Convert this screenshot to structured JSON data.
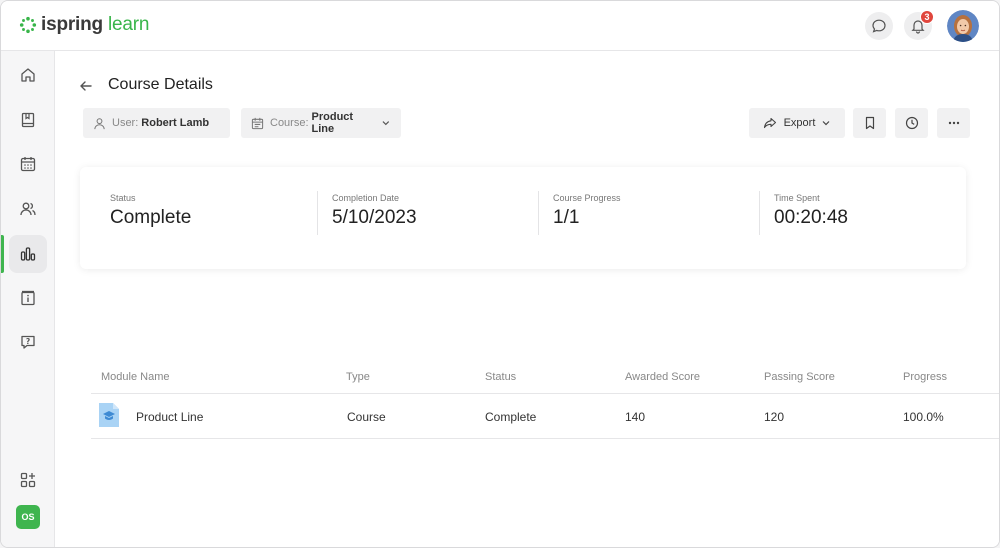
{
  "app": {
    "logo_brand": "ispring",
    "logo_product": "learn",
    "accent": "#3fb54f"
  },
  "header": {
    "notifications_count": "3"
  },
  "sidebar": {
    "items": [
      "home-icon",
      "book-icon",
      "calendar-icon",
      "users-icon",
      "reports-icon",
      "info-icon",
      "help-icon"
    ],
    "active_index": 4,
    "apps_icon": "apps-add-icon",
    "user_initials": "OS"
  },
  "page": {
    "title": "Course Details"
  },
  "filters": {
    "user_label": "User:",
    "user_value": "Robert Lamb",
    "course_label": "Course:",
    "course_value": "Product Line"
  },
  "toolbar": {
    "export_label": "Export"
  },
  "summary": [
    {
      "label": "Status",
      "value": "Complete"
    },
    {
      "label": "Completion Date",
      "value": "5/10/2023"
    },
    {
      "label": "Course Progress",
      "value": "1/1"
    },
    {
      "label": "Time Spent",
      "value": "00:20:48"
    }
  ],
  "table": {
    "columns": [
      "Module Name",
      "Type",
      "Status",
      "Awarded Score",
      "Passing Score",
      "Progress"
    ],
    "rows": [
      [
        "Product Line",
        "Course",
        "Complete",
        "140",
        "120",
        "100.0%"
      ]
    ]
  }
}
